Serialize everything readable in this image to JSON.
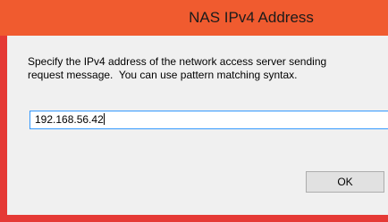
{
  "window": {
    "title": "NAS IPv4 Address"
  },
  "dialog": {
    "description_line1": "Specify the IPv4 address of the network access server sending",
    "description_line2": "request message.  You can use pattern matching syntax.",
    "ip_input_value": "192.168.56.42",
    "ok_label": "OK"
  },
  "colors": {
    "title_bar": "#f05b2f",
    "frame": "#e53935",
    "client_bg": "#f0f0f0",
    "input_focus_border": "#3399ff"
  }
}
